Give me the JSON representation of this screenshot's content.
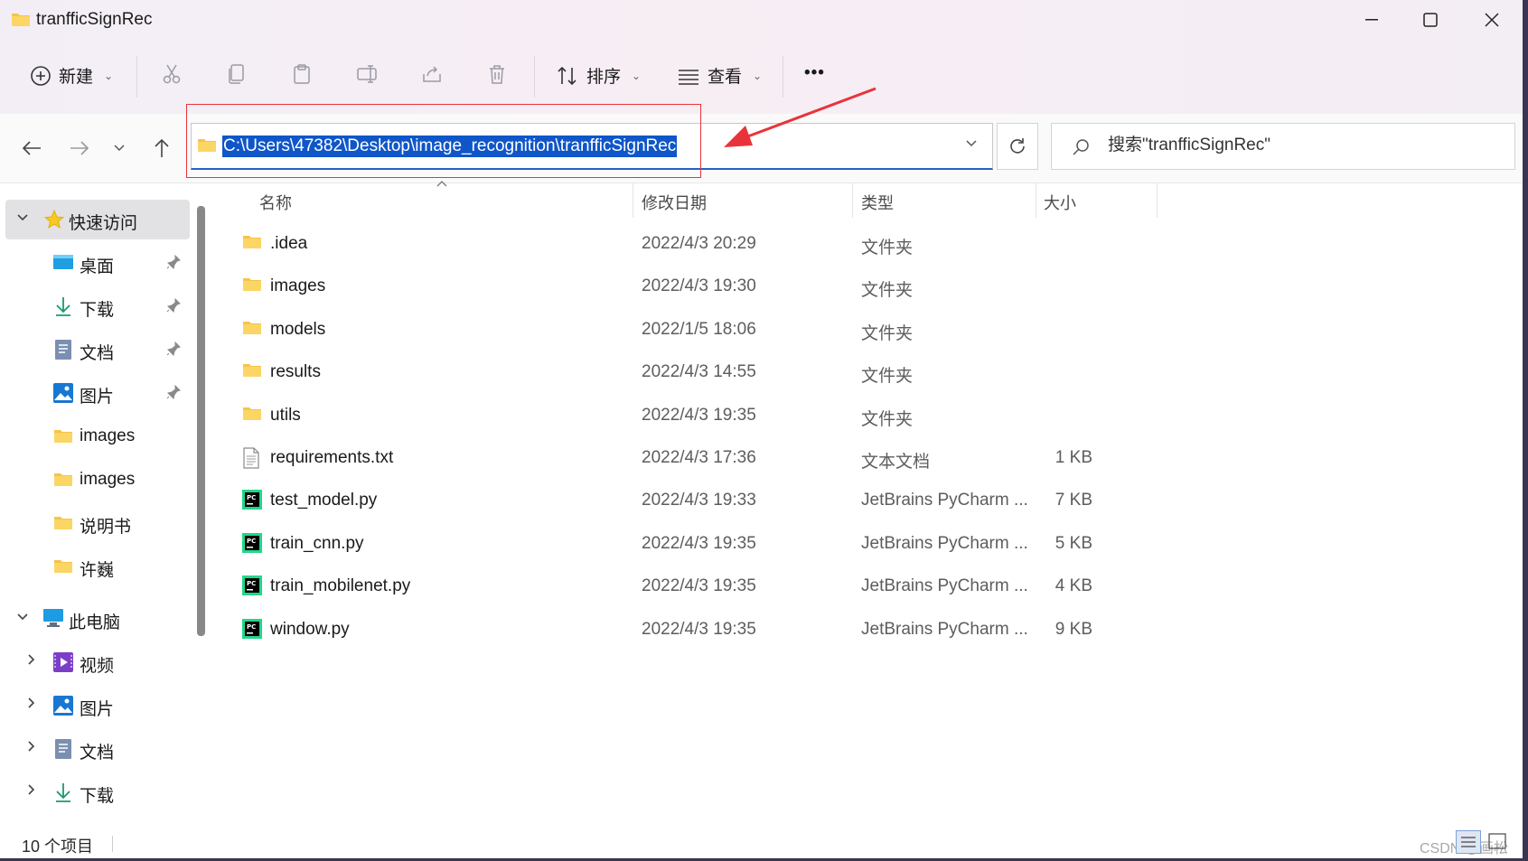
{
  "window": {
    "title": "tranfficSignRec"
  },
  "toolbar": {
    "new_label": "新建",
    "sort_label": "排序",
    "view_label": "查看",
    "more_label": "•••"
  },
  "nav": {
    "address_path": "C:\\Users\\47382\\Desktop\\image_recognition\\tranfficSignRec",
    "search_placeholder": "搜索\"tranfficSignRec\""
  },
  "sidebar": {
    "quick_access": "快速访问",
    "quick_items": [
      {
        "label": "桌面",
        "icon": "desktop-icon",
        "pinned": true
      },
      {
        "label": "下载",
        "icon": "download-icon",
        "pinned": true
      },
      {
        "label": "文档",
        "icon": "document-icon",
        "pinned": true
      },
      {
        "label": "图片",
        "icon": "picture-icon",
        "pinned": true
      },
      {
        "label": "images",
        "icon": "folder-icon",
        "pinned": false
      },
      {
        "label": "images",
        "icon": "folder-icon",
        "pinned": false
      },
      {
        "label": "说明书",
        "icon": "folder-icon",
        "pinned": false
      },
      {
        "label": "许巍",
        "icon": "folder-icon",
        "pinned": false
      }
    ],
    "this_pc": "此电脑",
    "pc_items": [
      {
        "label": "视频",
        "icon": "video-icon"
      },
      {
        "label": "图片",
        "icon": "picture-icon"
      },
      {
        "label": "文档",
        "icon": "document-icon"
      },
      {
        "label": "下载",
        "icon": "download-icon"
      }
    ]
  },
  "columns": {
    "name": "名称",
    "date": "修改日期",
    "type": "类型",
    "size": "大小"
  },
  "files": [
    {
      "name": ".idea",
      "date": "2022/4/3 20:29",
      "type": "文件夹",
      "size": "",
      "icon": "folder-icon"
    },
    {
      "name": "images",
      "date": "2022/4/3 19:30",
      "type": "文件夹",
      "size": "",
      "icon": "folder-icon"
    },
    {
      "name": "models",
      "date": "2022/1/5 18:06",
      "type": "文件夹",
      "size": "",
      "icon": "folder-icon"
    },
    {
      "name": "results",
      "date": "2022/4/3 14:55",
      "type": "文件夹",
      "size": "",
      "icon": "folder-icon"
    },
    {
      "name": "utils",
      "date": "2022/4/3 19:35",
      "type": "文件夹",
      "size": "",
      "icon": "folder-icon"
    },
    {
      "name": "requirements.txt",
      "date": "2022/4/3 17:36",
      "type": "文本文档",
      "size": "1 KB",
      "icon": "text-file-icon"
    },
    {
      "name": "test_model.py",
      "date": "2022/4/3 19:33",
      "type": "JetBrains PyCharm ...",
      "size": "7 KB",
      "icon": "pycharm-file-icon"
    },
    {
      "name": "train_cnn.py",
      "date": "2022/4/3 19:35",
      "type": "JetBrains PyCharm ...",
      "size": "5 KB",
      "icon": "pycharm-file-icon"
    },
    {
      "name": "train_mobilenet.py",
      "date": "2022/4/3 19:35",
      "type": "JetBrains PyCharm ...",
      "size": "4 KB",
      "icon": "pycharm-file-icon"
    },
    {
      "name": "window.py",
      "date": "2022/4/3 19:35",
      "type": "JetBrains PyCharm ...",
      "size": "9 KB",
      "icon": "pycharm-file-icon"
    }
  ],
  "status": {
    "count": "10 个项目",
    "watermark": "CSDN @画松"
  },
  "colors": {
    "accent": "#0f56c9",
    "annotation": "#e8333a",
    "folder": "#f6c34a"
  }
}
